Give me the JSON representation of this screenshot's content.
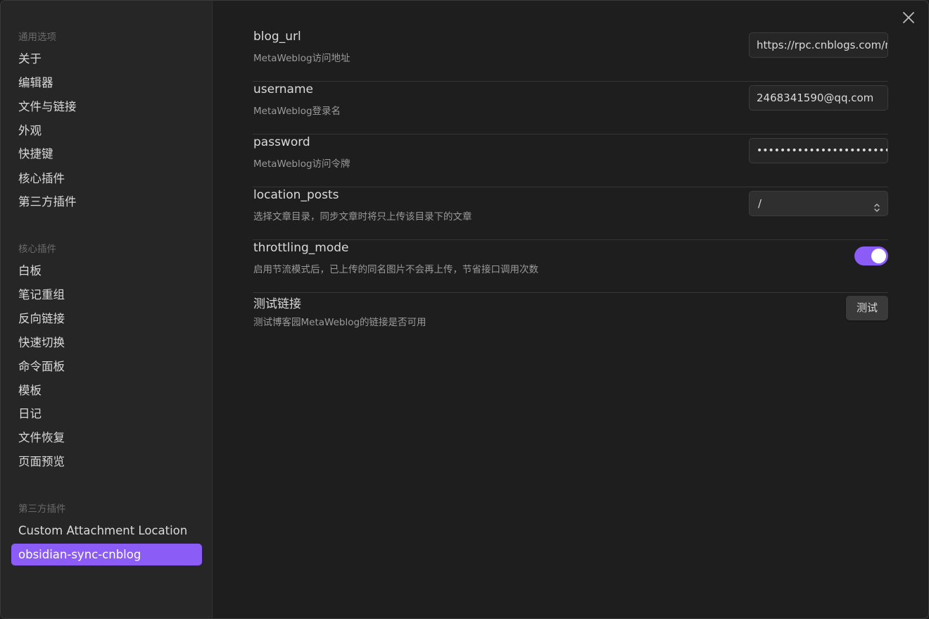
{
  "sidebar": {
    "general_title": "通用选项",
    "general_items": [
      "关于",
      "编辑器",
      "文件与链接",
      "外观",
      "快捷键",
      "核心插件",
      "第三方插件"
    ],
    "core_title": "核心插件",
    "core_items": [
      "白板",
      "笔记重组",
      "反向链接",
      "快速切换",
      "命令面板",
      "模板",
      "日记",
      "文件恢复",
      "页面预览"
    ],
    "third_party_title": "第三方插件",
    "third_party_items": [
      "Custom Attachment Location",
      "obsidian-sync-cnblog"
    ],
    "active_item": "obsidian-sync-cnblog"
  },
  "close_icon": "close-icon",
  "accent_color": "#8b5cf6",
  "settings": {
    "blog_url": {
      "name": "blog_url",
      "desc": "MetaWeblog访问地址",
      "value": "https://rpc.cnblogs.com/metaweblog/"
    },
    "username": {
      "name": "username",
      "desc": "MetaWeblog登录名",
      "value": "2468341590@qq.com"
    },
    "password": {
      "name": "password",
      "desc": "MetaWeblog访问令牌",
      "value": "••••••••••••••••••••••••••••••••"
    },
    "location_posts": {
      "name": "location_posts",
      "desc": "选择文章目录，同步文章时将只上传该目录下的文章",
      "value": "/"
    },
    "throttling_mode": {
      "name": "throttling_mode",
      "desc": "启用节流模式后，已上传的同名图片不会再上传，节省接口调用次数",
      "enabled": true
    },
    "test_link": {
      "name": "测试链接",
      "desc": "测试博客园MetaWeblog的链接是否可用",
      "button_label": "测试"
    }
  }
}
